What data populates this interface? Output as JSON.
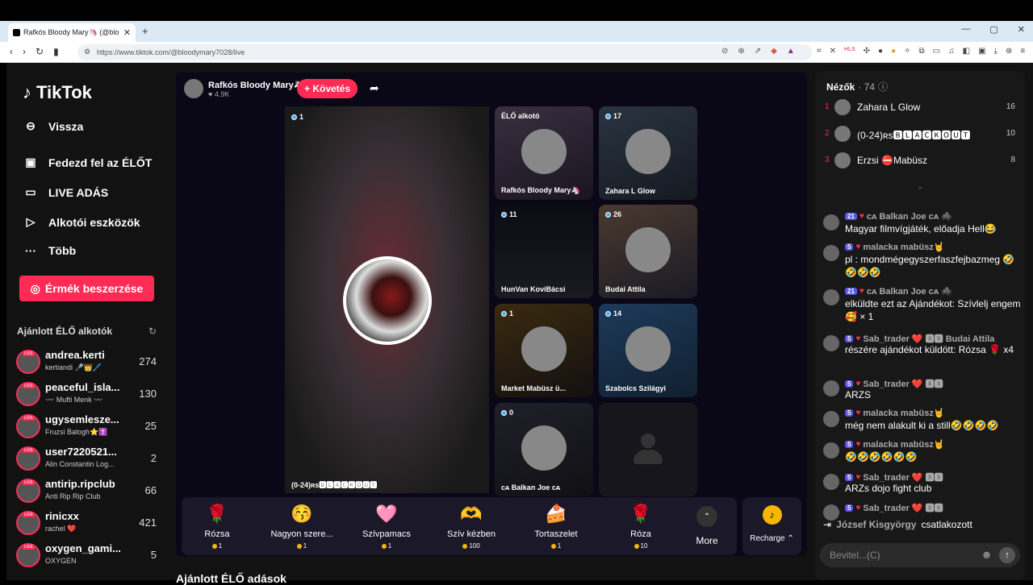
{
  "browser": {
    "tab_title": "Rafkós Bloody Mary🦄 (@blo",
    "url": "https://www.tiktok.com/@bloodymary7028/live"
  },
  "sidebar": {
    "logo": "TikTok",
    "back": "Vissza",
    "nav": [
      {
        "label": "Fedezd fel az ÉLŐT",
        "icon": "live-explore-icon"
      },
      {
        "label": "LIVE ADÁS",
        "icon": "video-camera-icon"
      },
      {
        "label": "Alkotói eszközök",
        "icon": "creator-tools-icon"
      },
      {
        "label": "Több",
        "icon": "more-dots-icon"
      }
    ],
    "earn": "Érmék beszerzése",
    "suggested_title": "Ajánlott ÉLŐ alkotók",
    "creators": [
      {
        "name": "andrea.kerti",
        "sub": "kertiandi 🎤👑🖊️",
        "count": "274"
      },
      {
        "name": "peaceful_isla...",
        "sub": "〰️ Mufti Menk 〰️",
        "count": "130"
      },
      {
        "name": "ugysemlesze...",
        "sub": "Fruzsi Balogh⭐✝️",
        "count": "25"
      },
      {
        "name": "user7220521...",
        "sub": "Alin Constantin Log...",
        "count": "2"
      },
      {
        "name": "antirip.ripclub",
        "sub": "Anti Rip Rip Club",
        "count": "66"
      },
      {
        "name": "rinicxx",
        "sub": "rachel ❤️",
        "count": "421"
      },
      {
        "name": "oxygen_gami...",
        "sub": "OXYGEN",
        "count": "5"
      }
    ],
    "live_badge": "LIVE"
  },
  "stream": {
    "host": "Rafkós Bloody Mary🦄",
    "likes": "4.9K",
    "follow": "+ Követés",
    "big": {
      "viewers": "1",
      "name": "(0-24)ʀs🅱🅻🅰🅲🅺🅾🆄🆃"
    },
    "grid": [
      {
        "viewers": "",
        "name": "Rafkós Bloody Mary🦄",
        "label": "ÉLŐ alkotó"
      },
      {
        "viewers": "17",
        "name": "Zahara L Glow"
      },
      {
        "viewers": "11",
        "name": "HunVan KoviBácsi"
      },
      {
        "viewers": "26",
        "name": "Budai Attila"
      },
      {
        "viewers": "1",
        "name": "Market Mabüsz ü..."
      },
      {
        "viewers": "14",
        "name": "Szabolcs Szilágyi"
      },
      {
        "viewers": "0",
        "name": "ᴄᴀ Balkan Joe ᴄᴀ"
      }
    ]
  },
  "gifts": [
    {
      "emoji": "🌹",
      "name": "Rózsa",
      "price": "1"
    },
    {
      "emoji": "😚",
      "name": "Nagyon szere...",
      "price": "1"
    },
    {
      "emoji": "🩷",
      "name": "Szívpamacs",
      "price": "1"
    },
    {
      "emoji": "🫶",
      "name": "Szív kézben",
      "price": "100"
    },
    {
      "emoji": "🍰",
      "name": "Tortaszelet",
      "price": "1"
    },
    {
      "emoji": "🌹",
      "name": "Róza",
      "price": "10"
    }
  ],
  "more_label": "More",
  "recharge_label": "Recharge ⌃",
  "bottom_title": "Ajánlott ÉLŐ adások",
  "viewers": {
    "title": "Nézők",
    "count": "· 74",
    "list": [
      {
        "rank": "1",
        "name": "Zahara L Glow",
        "score": "16"
      },
      {
        "rank": "2",
        "name": "(0-24)ʀs🅱🅻🅰🅲🅺🅾🆄🆃",
        "score": "10"
      },
      {
        "rank": "3",
        "name": "Erzsi ⛔Mabüsz",
        "score": "8"
      }
    ]
  },
  "chat": [
    {
      "level": "21",
      "user": "ᴄᴀ Balkan Joe ᴄᴀ 🕷️",
      "msg": "Magyar filmvígjáték, előadja Hell😂"
    },
    {
      "level": "5",
      "user": "malacka mabüsz🤘",
      "msg": "pl : mondmégegyszerfaszfejbazmeg 🤣🤣🤣🤣"
    },
    {
      "level": "21",
      "user": "ᴄᴀ Balkan Joe ᴄᴀ 🕷️",
      "msg": "elküldte ezt az Ajándékot: Szívlelj engem 🥰 × 1"
    },
    {
      "level": "5",
      "user": "Sab_trader ❤️ 🆇🆇 Budai Attila",
      "msg": "részére ajándékot küldött: Rózsa 🌹 x4"
    },
    {
      "level": "5",
      "user": "Sab_trader ❤️ 🆇🆇",
      "msg": "ARZS"
    },
    {
      "level": "5",
      "user": "malacka mabüsz🤘",
      "msg": "még nem alakult ki a still🤣🤣🤣🤣"
    },
    {
      "level": "5",
      "user": "malacka mabüsz🤘",
      "msg": "🤣🤣🤣🤣🤣🤣"
    },
    {
      "level": "5",
      "user": "Sab_trader ❤️ 🆇🆇",
      "msg": "ARZs dojo fight club"
    },
    {
      "level": "5",
      "user": "Sab_trader ❤️ 🆇🆇",
      "msg": ""
    }
  ],
  "joined": {
    "name": "József Kisgyörgy",
    "text": "csatlakozott"
  },
  "input_placeholder": "Bevitel...(C)"
}
